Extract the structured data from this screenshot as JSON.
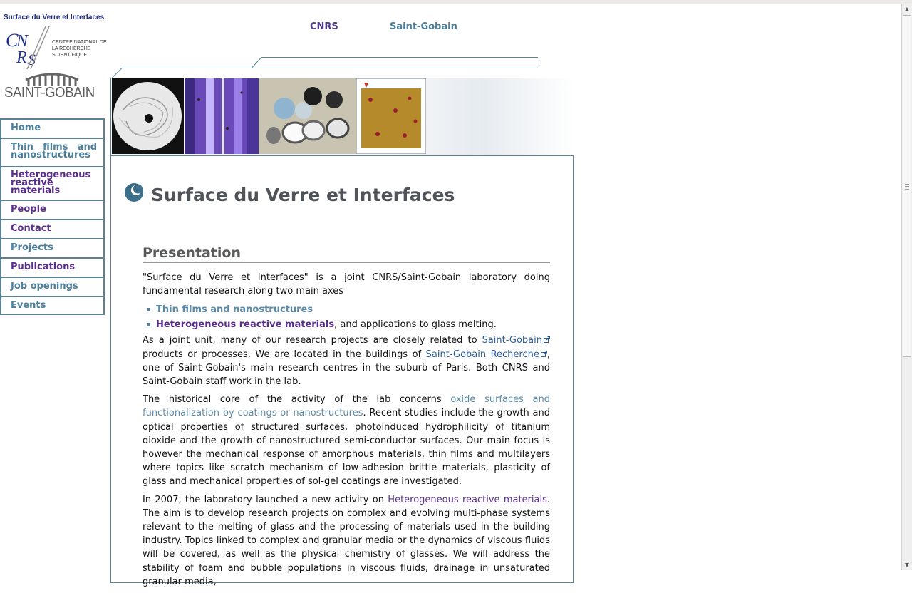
{
  "logo": {
    "title": "Surface du Verre et Interfaces",
    "cnrs_text": "CENTRE NATIONAL DE LA RECHERCHE SCIENTIFIQUE",
    "cnrs_mark": "CNRS",
    "saint_gobain": "SAINT-GOBAIN"
  },
  "header": {
    "link_cnrs": "CNRS",
    "link_saint_gobain": "Saint-Gobain"
  },
  "sidebar": {
    "items": [
      {
        "label": "Home"
      },
      {
        "label": "Thin films and nanostructures"
      },
      {
        "label": "Heterogeneous reactive materials"
      },
      {
        "label": "People"
      },
      {
        "label": "Contact"
      },
      {
        "label": "Projects"
      },
      {
        "label": "Publications"
      },
      {
        "label": "Job openings"
      },
      {
        "label": "Events"
      }
    ]
  },
  "page": {
    "title": "Surface du Verre et Interfaces",
    "section_title": "Presentation",
    "intro": "\"Surface du Verre et Interfaces\" is a joint CNRS/Saint-Gobain laboratory doing fundamental research along two main axes",
    "axes": [
      {
        "link": "Thin films and nanostructures",
        "after": ""
      },
      {
        "link": "Heterogeneous reactive materials",
        "after": ", and applications to glass melting."
      }
    ],
    "p2": {
      "t1": "As a joint unit, many of our research projects are closely related to ",
      "link1": "Saint-Gobain",
      "t2": " products or processes. We are located in the buildings of ",
      "link2": "Saint-Gobain Recherche",
      "t3": ", one of Saint-Gobain's main research centres in the suburb of Paris. Both CNRS and Saint-Gobain staff work in the lab."
    },
    "p3": {
      "t1": "The historical core of the activity of the lab concerns ",
      "link": "oxide surfaces and functionalization by coatings or nanostructures",
      "t2": ". Recent studies include the growth and optical properties of structured surfaces, photoinduced hydrophilicity of titanium dioxide and the growth of nanostructured semi-conductor surfaces. Our main focus is however the mechanical response of amorphous materials, thin films and multilayers where topics like scratch mechanism of low-adhesion brittle materials, plasticity of glass and mechanical properties of sol-gel coatings are investigated."
    },
    "p4": {
      "t1": "In 2007, the laboratory launched a new activity on ",
      "link": "Heterogeneous reactive materials",
      "t2": ". The aim is to develop research projects on complex and evolving multi-phase systems relevant to the melting of glass and the processing of materials used in the building industry. Topics linked to complex and granular media or the dynamics of viscous fluids will be covered, as well as the physical chemistry of glasses. We will address the stability of foam and bubble populations in viscous fluids, drainage in unsaturated granular media,"
    }
  },
  "colors": {
    "teal": "#4b7f9b",
    "purple": "#5a2f8c",
    "border": "#5b8193",
    "title_gray": "#4e5459"
  }
}
